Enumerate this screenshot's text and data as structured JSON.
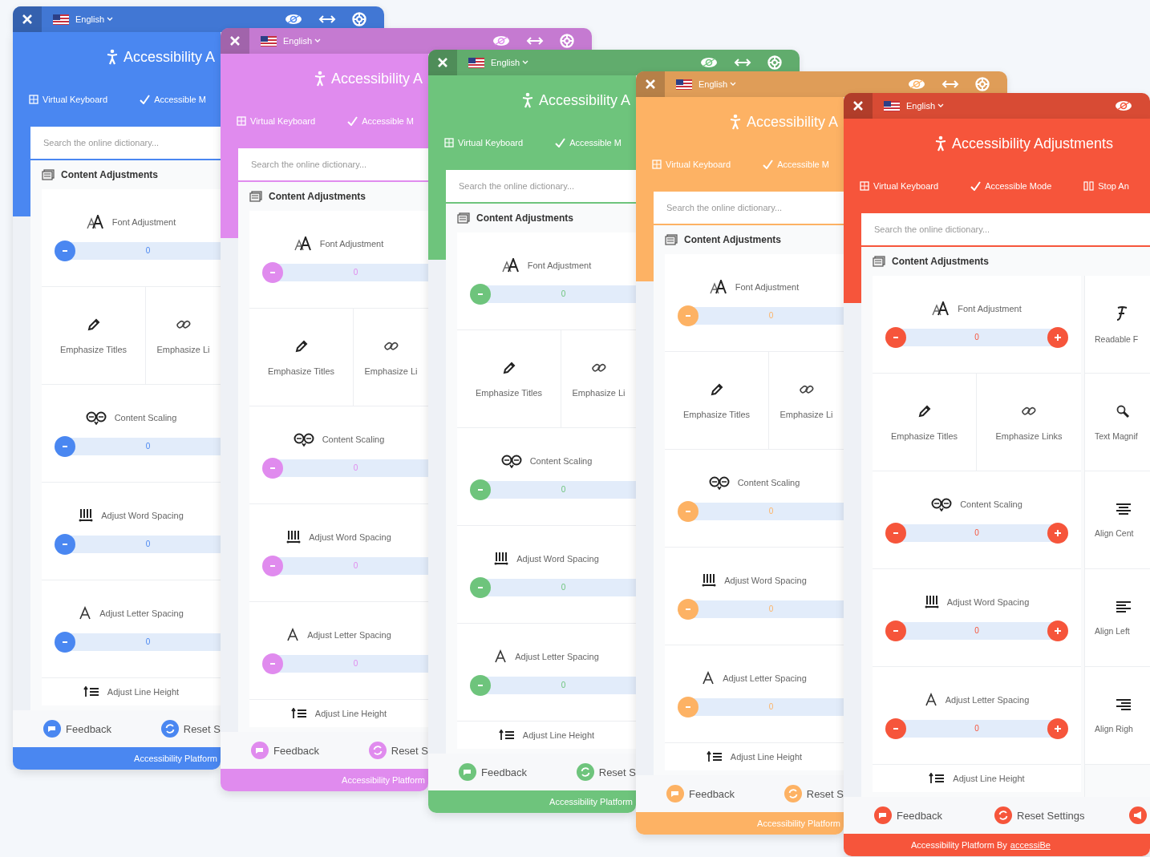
{
  "panels": [
    {
      "color": "#4a87f1",
      "language": "English",
      "title": "Accessibility A",
      "tabs": [
        {
          "label": "Virtual Keyboard"
        },
        {
          "label": "Accessible M"
        }
      ],
      "search": {
        "placeholder": "Search the online dictionary..."
      },
      "section": "Content Adjustments",
      "cards": [
        {
          "kind": "slider",
          "label": "Font Adjustment",
          "value": "0"
        },
        {
          "kind": "pair",
          "items": [
            "Emphasize Titles",
            "Emphasize Li"
          ]
        },
        {
          "kind": "slider",
          "label": "Content Scaling",
          "value": "0"
        },
        {
          "kind": "slider",
          "label": "Adjust Word Spacing",
          "value": "0"
        },
        {
          "kind": "slider",
          "label": "Adjust Letter Spacing",
          "value": "0"
        },
        {
          "kind": "row",
          "label": "Adjust Line Height"
        }
      ],
      "footer": [
        "Feedback",
        "Reset S"
      ],
      "credit": "Accessibility Platform"
    },
    {
      "color": "#e08bee",
      "language": "English",
      "title": "Accessibility A",
      "tabs": [
        {
          "label": "Virtual Keyboard"
        },
        {
          "label": "Accessible M"
        }
      ],
      "search": {
        "placeholder": "Search the online dictionary..."
      },
      "section": "Content Adjustments",
      "cards": [
        {
          "kind": "slider",
          "label": "Font Adjustment",
          "value": "0"
        },
        {
          "kind": "pair",
          "items": [
            "Emphasize Titles",
            "Emphasize Li"
          ]
        },
        {
          "kind": "slider",
          "label": "Content Scaling",
          "value": "0"
        },
        {
          "kind": "slider",
          "label": "Adjust Word Spacing",
          "value": "0"
        },
        {
          "kind": "slider",
          "label": "Adjust Letter Spacing",
          "value": "0"
        },
        {
          "kind": "row",
          "label": "Adjust Line Height"
        }
      ],
      "footer": [
        "Feedback",
        "Reset S"
      ],
      "credit": "Accessibility Platform"
    },
    {
      "color": "#6ec47c",
      "language": "English",
      "title": "Accessibility A",
      "tabs": [
        {
          "label": "Virtual Keyboard"
        },
        {
          "label": "Accessible M"
        }
      ],
      "search": {
        "placeholder": "Search the online dictionary..."
      },
      "section": "Content Adjustments",
      "cards": [
        {
          "kind": "slider",
          "label": "Font Adjustment",
          "value": "0"
        },
        {
          "kind": "pair",
          "items": [
            "Emphasize Titles",
            "Emphasize Li"
          ]
        },
        {
          "kind": "slider",
          "label": "Content Scaling",
          "value": "0"
        },
        {
          "kind": "slider",
          "label": "Adjust Word Spacing",
          "value": "0"
        },
        {
          "kind": "slider",
          "label": "Adjust Letter Spacing",
          "value": "0"
        },
        {
          "kind": "row",
          "label": "Adjust Line Height"
        }
      ],
      "footer": [
        "Feedback",
        "Reset S"
      ],
      "credit": "Accessibility Platform"
    },
    {
      "color": "#fdb264",
      "language": "English",
      "title": "Accessibility A",
      "tabs": [
        {
          "label": "Virtual Keyboard"
        },
        {
          "label": "Accessible M"
        }
      ],
      "search": {
        "placeholder": "Search the online dictionary..."
      },
      "section": "Content Adjustments",
      "cards": [
        {
          "kind": "slider",
          "label": "Font Adjustment",
          "value": "0"
        },
        {
          "kind": "pair",
          "items": [
            "Emphasize Titles",
            "Emphasize Li"
          ]
        },
        {
          "kind": "slider",
          "label": "Content Scaling",
          "value": "0"
        },
        {
          "kind": "slider",
          "label": "Adjust Word Spacing",
          "value": "0"
        },
        {
          "kind": "slider",
          "label": "Adjust Letter Spacing",
          "value": "0"
        },
        {
          "kind": "row",
          "label": "Adjust Line Height"
        }
      ],
      "footer": [
        "Feedback",
        "Reset S"
      ],
      "credit": "Accessibility Platform"
    },
    {
      "color": "#f6553b",
      "language": "English",
      "title": "Accessibility Adjustments",
      "tabs": [
        {
          "label": "Virtual Keyboard"
        },
        {
          "label": "Accessible Mode"
        },
        {
          "label": "Stop An"
        }
      ],
      "search": {
        "placeholder": "Search the online dictionary..."
      },
      "section": "Content Adjustments",
      "cards": [
        {
          "kind": "slider",
          "label": "Font Adjustment",
          "value": "0"
        },
        {
          "kind": "pair",
          "items": [
            "Emphasize Titles",
            "Emphasize Links"
          ]
        },
        {
          "kind": "slider",
          "label": "Content Scaling",
          "value": "0"
        },
        {
          "kind": "slider",
          "label": "Adjust Word Spacing",
          "value": "0"
        },
        {
          "kind": "slider",
          "label": "Adjust Letter Spacing",
          "value": "0"
        },
        {
          "kind": "row",
          "label": "Adjust Line Height"
        }
      ],
      "side_items": [
        "Readable F",
        "Text Magnif",
        "Align Cent",
        "Align Left",
        "Align Righ"
      ],
      "footer": [
        "Feedback",
        "Reset Settings"
      ],
      "credit": "Accessibility Platform By",
      "credit_link": "accessiBe"
    }
  ]
}
